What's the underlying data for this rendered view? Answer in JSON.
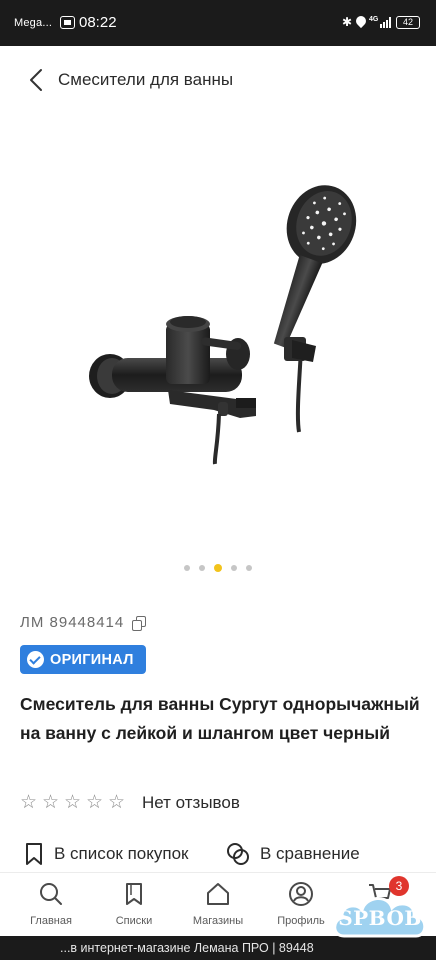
{
  "status_bar": {
    "carrier": "Mega...",
    "time": "08:22",
    "network": "4G",
    "battery": "42"
  },
  "header": {
    "title": "Смесители для ванны"
  },
  "gallery": {
    "dot_count": 5,
    "active_index": 2
  },
  "product": {
    "article": "ЛМ  89448414",
    "badge": "ОРИГИНАЛ",
    "title": "Смеситель для ванны Сургут однорычажный на ванну с лейкой и шлангом цвет черный",
    "rating_stars": 5,
    "rating_value": 0,
    "reviews_label": "Нет отзывов",
    "add_to_list": "В список покупок",
    "compare": "В сравнение"
  },
  "bottom_nav": {
    "items": [
      {
        "label": "Главная",
        "icon": "search-icon"
      },
      {
        "label": "Списки",
        "icon": "bookmark-icon"
      },
      {
        "label": "Магазины",
        "icon": "store-icon"
      },
      {
        "label": "Профиль",
        "icon": "user-icon"
      },
      {
        "label": "",
        "icon": "cart-icon"
      }
    ],
    "cart_count": "3"
  },
  "footer": {
    "text": "...в интернет-магазине Лемана ПРО | 89448"
  },
  "watermark": {
    "text": "SPBOB"
  },
  "colors": {
    "badge_blue": "#2f7fde",
    "active_dot": "#f2c31c",
    "cart_badge": "#e0352d"
  }
}
